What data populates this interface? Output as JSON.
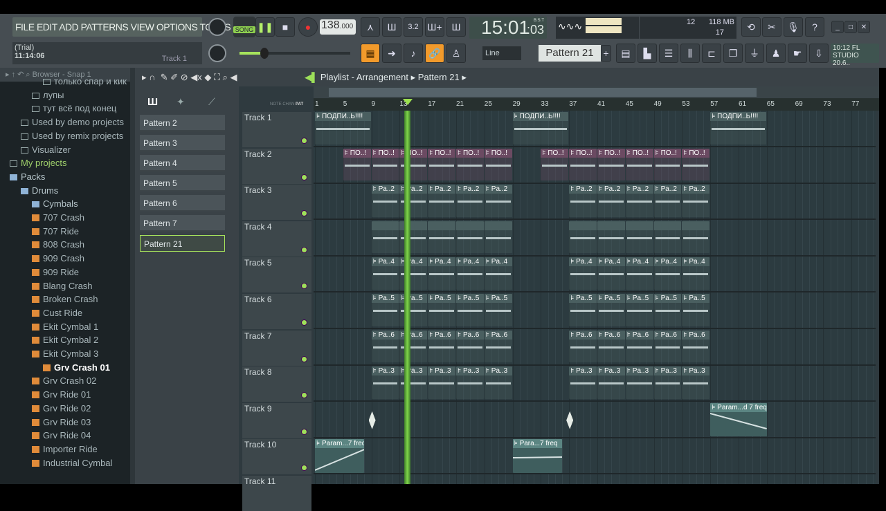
{
  "menu": {
    "items": "FILE EDIT ADD PATTERNS VIEW OPTIONS TOOLS HELP"
  },
  "hint": {
    "line1": "(Trial)",
    "line2": "11:14:06",
    "track": "Track 1"
  },
  "transport": {
    "mode": "SONG",
    "tempo": "138",
    "tempo_dec": ".000",
    "time_main": "15:01",
    "time_sub": ":03",
    "time_unit": "B:S:T"
  },
  "meter": {
    "cpu": "12",
    "mem": "118 MB",
    "poly": "17"
  },
  "snap": {
    "value": "Line"
  },
  "pattern_selector": {
    "value": "Pattern 21"
  },
  "news": {
    "line1": "10:12  FL",
    "line2": "STUDIO 20.6.."
  },
  "browser": {
    "title": "Browser - Snap 1",
    "items": [
      {
        "label": "только спар и кик",
        "indent": 3,
        "kind": "folder"
      },
      {
        "label": "лупы",
        "indent": 2,
        "kind": "folder"
      },
      {
        "label": "тут всё под конец",
        "indent": 2,
        "kind": "folder"
      },
      {
        "label": "Used by demo projects",
        "indent": 1,
        "kind": "folder"
      },
      {
        "label": "Used by remix projects",
        "indent": 1,
        "kind": "folder"
      },
      {
        "label": "Visualizer",
        "indent": 1,
        "kind": "folder"
      },
      {
        "label": "My projects",
        "indent": 0,
        "kind": "projects"
      },
      {
        "label": "Packs",
        "indent": 0,
        "kind": "pack"
      },
      {
        "label": "Drums",
        "indent": 1,
        "kind": "pack"
      },
      {
        "label": "Cymbals",
        "indent": 2,
        "kind": "pack"
      },
      {
        "label": "707 Crash",
        "indent": 2,
        "kind": "file"
      },
      {
        "label": "707 Ride",
        "indent": 2,
        "kind": "file"
      },
      {
        "label": "808 Crash",
        "indent": 2,
        "kind": "file"
      },
      {
        "label": "909 Crash",
        "indent": 2,
        "kind": "file"
      },
      {
        "label": "909 Ride",
        "indent": 2,
        "kind": "file"
      },
      {
        "label": "Blang Crash",
        "indent": 2,
        "kind": "file"
      },
      {
        "label": "Broken Crash",
        "indent": 2,
        "kind": "file"
      },
      {
        "label": "Cust Ride",
        "indent": 2,
        "kind": "file"
      },
      {
        "label": "Ekit Cymbal 1",
        "indent": 2,
        "kind": "file"
      },
      {
        "label": "Ekit Cymbal 2",
        "indent": 2,
        "kind": "file"
      },
      {
        "label": "Ekit Cymbal 3",
        "indent": 2,
        "kind": "file"
      },
      {
        "label": "Grv Crash 01",
        "indent": 3,
        "kind": "selected"
      },
      {
        "label": "Grv Crash 02",
        "indent": 2,
        "kind": "file"
      },
      {
        "label": "Grv Ride 01",
        "indent": 2,
        "kind": "file"
      },
      {
        "label": "Grv Ride 02",
        "indent": 2,
        "kind": "file"
      },
      {
        "label": "Grv Ride 03",
        "indent": 2,
        "kind": "file"
      },
      {
        "label": "Grv Ride 04",
        "indent": 2,
        "kind": "file"
      },
      {
        "label": "Importer Ride",
        "indent": 2,
        "kind": "file"
      },
      {
        "label": "Industrial Cymbal",
        "indent": 2,
        "kind": "file"
      }
    ]
  },
  "patterns": [
    "Pattern 2",
    "Pattern 3",
    "Pattern 4",
    "Pattern 5",
    "Pattern 6",
    "Pattern 7",
    "Pattern 21"
  ],
  "playlist": {
    "title": "Playlist - Arrangement",
    "breadcrumb": "Pattern 21",
    "col_labels": [
      "NOTE",
      "CHAN",
      "PAT"
    ],
    "bar_labels": [
      "1",
      "5",
      "9",
      "13",
      "17",
      "21",
      "25",
      "29",
      "33",
      "37",
      "41",
      "45",
      "49",
      "53",
      "57",
      "61",
      "65",
      "69",
      "73",
      "77"
    ],
    "playhead_bar": 14,
    "tracks": [
      "Track 1",
      "Track 2",
      "Track 3",
      "Track 4",
      "Track 5",
      "Track 6",
      "Track 7",
      "Track 8",
      "Track 9",
      "Track 10",
      "Track 11"
    ],
    "clips": [
      {
        "t": 0,
        "s": 1,
        "l": 8,
        "label": "ПОДПИ..Ь!!!!",
        "c": "#4a5f60"
      },
      {
        "t": 0,
        "s": 29,
        "l": 8,
        "label": "ПОДПИ..Ь!!!!",
        "c": "#4a5f60"
      },
      {
        "t": 0,
        "s": 57,
        "l": 8,
        "label": "ПОДПИ..Ь!!!!",
        "c": "#4a5f60"
      },
      {
        "t": 1,
        "s": 5,
        "l": 4,
        "label": "ПО..!",
        "c": "#6b4a62"
      },
      {
        "t": 1,
        "s": 9,
        "l": 4,
        "label": "ПО..!",
        "c": "#6b4a62"
      },
      {
        "t": 1,
        "s": 13,
        "l": 4,
        "label": "ПО..!",
        "c": "#6b4a62"
      },
      {
        "t": 1,
        "s": 17,
        "l": 4,
        "label": "ПО..!",
        "c": "#6b4a62"
      },
      {
        "t": 1,
        "s": 21,
        "l": 4,
        "label": "ПО..!",
        "c": "#6b4a62"
      },
      {
        "t": 1,
        "s": 25,
        "l": 4,
        "label": "ПО..!",
        "c": "#6b4a62"
      },
      {
        "t": 1,
        "s": 33,
        "l": 4,
        "label": "ПО..!",
        "c": "#6b4a62"
      },
      {
        "t": 1,
        "s": 37,
        "l": 4,
        "label": "ПО..!",
        "c": "#6b4a62"
      },
      {
        "t": 1,
        "s": 41,
        "l": 4,
        "label": "ПО..!",
        "c": "#6b4a62"
      },
      {
        "t": 1,
        "s": 45,
        "l": 4,
        "label": "ПО..!",
        "c": "#6b4a62"
      },
      {
        "t": 1,
        "s": 49,
        "l": 4,
        "label": "ПО..!",
        "c": "#6b4a62"
      },
      {
        "t": 1,
        "s": 53,
        "l": 4,
        "label": "ПО..!",
        "c": "#6b4a62"
      }
    ],
    "repeat_rows": [
      {
        "t": 2,
        "label": "Pa..2"
      },
      {
        "t": 3,
        "label": ""
      },
      {
        "t": 4,
        "label": "Pa..4"
      },
      {
        "t": 5,
        "label": "Pa..5"
      },
      {
        "t": 6,
        "label": "Pa..6"
      },
      {
        "t": 7,
        "label": "Pa..3"
      }
    ],
    "automation": [
      {
        "t": 9,
        "s": 1,
        "l": 7,
        "label": "Param...7 freq"
      },
      {
        "t": 9,
        "s": 29,
        "l": 7,
        "label": "Para...7 freq"
      },
      {
        "t": 8,
        "s": 57,
        "l": 8,
        "label": "Param...d 7 freq"
      }
    ]
  }
}
